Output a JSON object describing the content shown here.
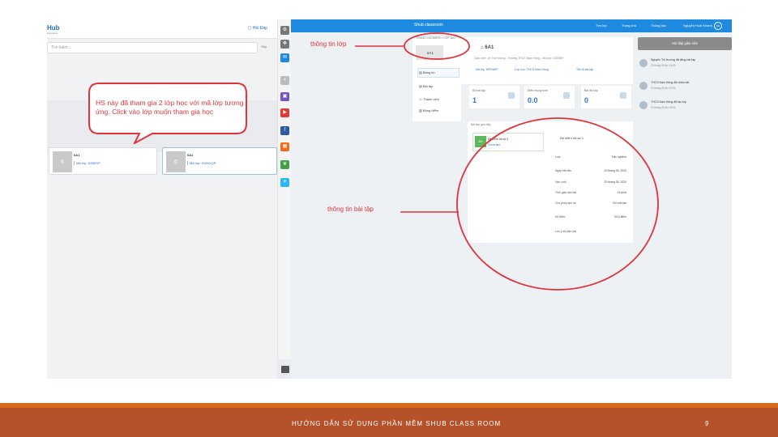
{
  "left_screen": {
    "logo": "Hub",
    "logo_sub": "Education",
    "class_link": "Hỏi Đáp",
    "search_placeholder": "Tìm kiếm...",
    "search_btn": "Sắp",
    "classes": [
      {
        "avatar": "6",
        "name": "6A1",
        "code": "Mã lớp: DZ89SP"
      },
      {
        "avatar": "6",
        "name": "6A1",
        "code": "Mã lớp: KWNXQP"
      }
    ]
  },
  "callout_left": "HS này đã tham gia 2 lớp học với mã lớp tương ứng. Click vào lớp muốn tham gia học",
  "annotation_class_info": "thông tin lớp",
  "annotation_exercise_info": "thông tin bài tập",
  "right_screen": {
    "site": "Shub classroom",
    "nav": [
      "Tìm lớp",
      "Trang chủ",
      "Thông báo"
    ],
    "user": "Nguyễn Hoài Khanh",
    "user_initials": "NH",
    "breadcrumb": "TRANG CHỦ/ĐIỂM > LỚP 6A1",
    "avatar_label": "6A1",
    "class_title": "6A1",
    "class_desc": "Giáo viên: Lê Thị Hương - Trường THCS Nam Hồng - Mã lớp: DZ89SP",
    "pills": [
      "Mã lớp: WPH6SP",
      "Lớp học: THCS Nam Hồng",
      "Tất cả bài tập"
    ],
    "menu": [
      "Bảng tin",
      "Bài tập",
      "Thành viên",
      "Bảng điểm"
    ],
    "stats": [
      {
        "label": "Số bài tập",
        "value": "1"
      },
      {
        "label": "Điểm trung bình",
        "value": "0.0"
      },
      {
        "label": "Bài đã nộp",
        "value": "0"
      }
    ],
    "exercise_header": "Bài tập gần đây",
    "exercise_item": {
      "badge": "Đề",
      "title": "Đề kiểm tra số 1",
      "subtitle": "Chưa làm"
    },
    "detail_title": "Đề kiểm tra số 1",
    "details": [
      {
        "k": "Loại",
        "v": "Trắc nghiệm"
      },
      {
        "k": "Ngày bắt đầu",
        "v": "20 tháng 05, 2020"
      },
      {
        "k": "Hạn chót",
        "v": "20 tháng 05, 2020"
      },
      {
        "k": "Thời gian làm bài",
        "v": "15 phút"
      },
      {
        "k": "Cho phép làm lại",
        "v": "Chỉ một lần"
      },
      {
        "k": "Số điểm",
        "v": "0/10 điểm"
      },
      {
        "k": "Lưu ý khi làm bài",
        "v": ""
      }
    ],
    "join_btn": "Hỏi đáp giáo viên",
    "feed": [
      {
        "t1": "Nguyễn Thị Hương đã đăng bài tập",
        "t2": "20 tháng 05 lúc 14:00"
      },
      {
        "t1": "THCS Nam Hồng đã chấm bài",
        "t2": "20 tháng 05 lúc 10:00"
      },
      {
        "t1": "THCS Nam Hồng đã tạo lớp",
        "t2": "20 tháng 05 lúc 09:00"
      }
    ]
  },
  "footer": {
    "title": "HƯỚNG DẪN SỬ DỤNG PHẦN MỀM SHUB CLASS ROOM",
    "page": "9"
  }
}
